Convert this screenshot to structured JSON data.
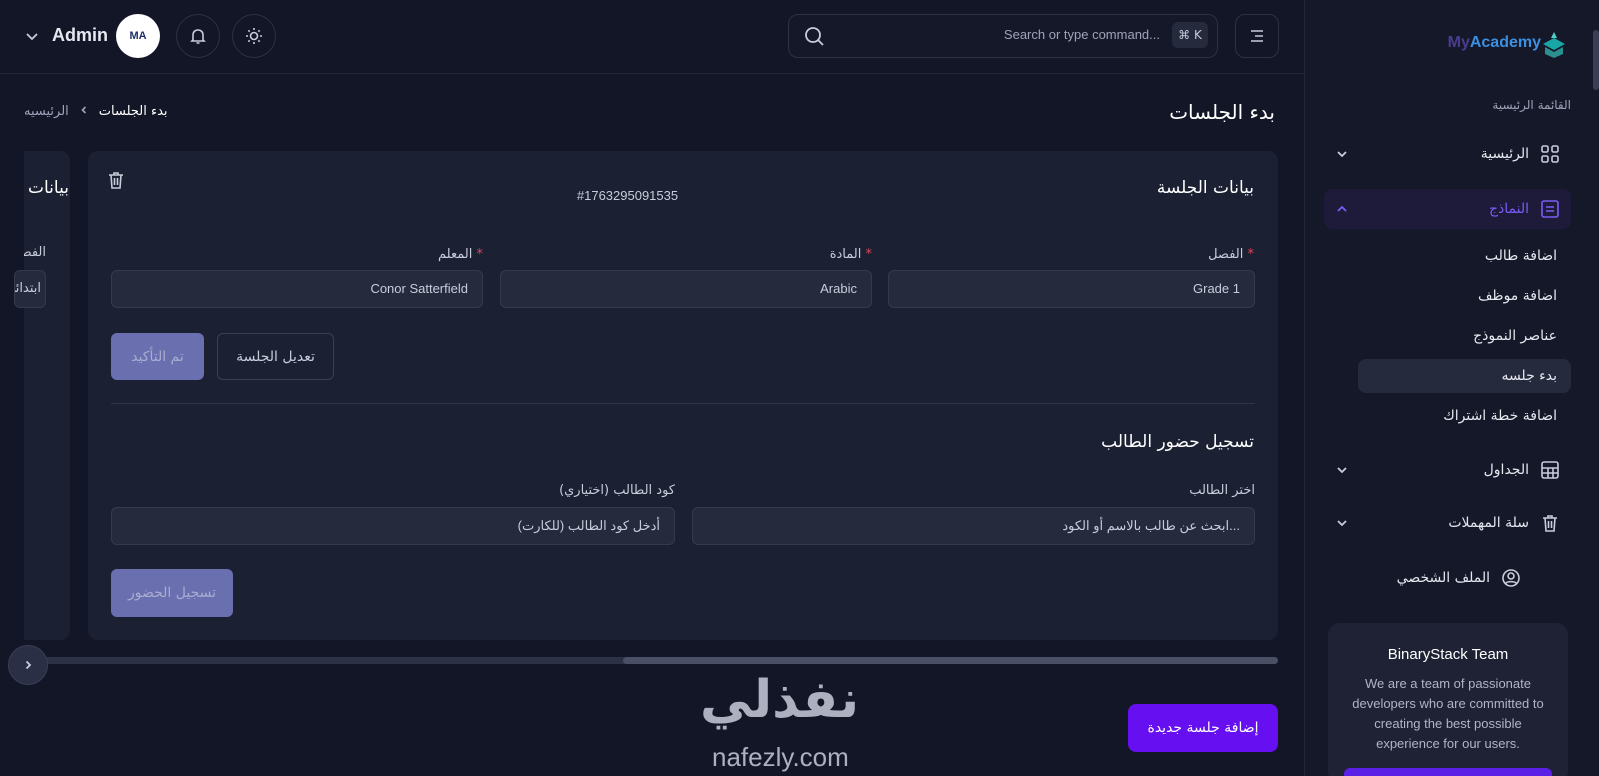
{
  "brand": {
    "prefix": "My",
    "name": "Academy"
  },
  "topbar": {
    "search_placeholder": "Search or type command...",
    "shortcut": "⌘ K",
    "admin_name": "Admin",
    "avatar_text": "MA"
  },
  "sidebar": {
    "section_label": "القائمة الرئيسية",
    "items": [
      {
        "label": "الرئيسية",
        "icon": "grid-icon"
      },
      {
        "label": "النماذج",
        "icon": "form-icon"
      },
      {
        "label": "الجداول",
        "icon": "table-icon"
      },
      {
        "label": "سلة المهملات",
        "icon": "trash-icon"
      },
      {
        "label": "الملف الشخصي",
        "icon": "user-circle-icon"
      }
    ],
    "sub_items": [
      "اضافة طالب",
      "اضافة موظف",
      "عناصر النموذج",
      "بدء جلسه",
      "اضافة خطة اشتراك"
    ],
    "team": {
      "title": "BinaryStack Team",
      "description": "We are a team of passionate developers who are committed to creating the best possible experience for our users."
    }
  },
  "page": {
    "title": "بدء الجلسات",
    "breadcrumb_home": "الرئيسيه",
    "breadcrumb_current": "بدء الجلسات"
  },
  "session_card": {
    "title": "بيانات الجلسة",
    "id": "#1763295091535",
    "class_label": "الفصل",
    "class_value": "Grade 1",
    "subject_label": "المادة",
    "subject_value": "Arabic",
    "teacher_label": "المعلم",
    "teacher_value": "Conor Satterfield",
    "edit_button": "تعديل الجلسة",
    "confirm_button": "تم التأكيد",
    "attendance_title": "تسجيل حضور الطالب",
    "student_label": "اختر الطالب",
    "student_placeholder": "ابحث عن طالب بالاسم أو الكود...",
    "code_label": "كود الطالب (اختياري)",
    "code_placeholder": "أدخل كود الطالب (للكارت)",
    "record_button": "تسجيل الحضور"
  },
  "side_card": {
    "title": "بيانات",
    "label": "الفصل",
    "value": "ابتدائي"
  },
  "add_session_button": "إضافة جلسة جديدة",
  "watermark": {
    "arabic": "نفذلي",
    "latin": "nafezly.com"
  },
  "colors": {
    "accent": "#6610f2",
    "active_text": "#7b5cf5",
    "required": "#e0445a"
  }
}
